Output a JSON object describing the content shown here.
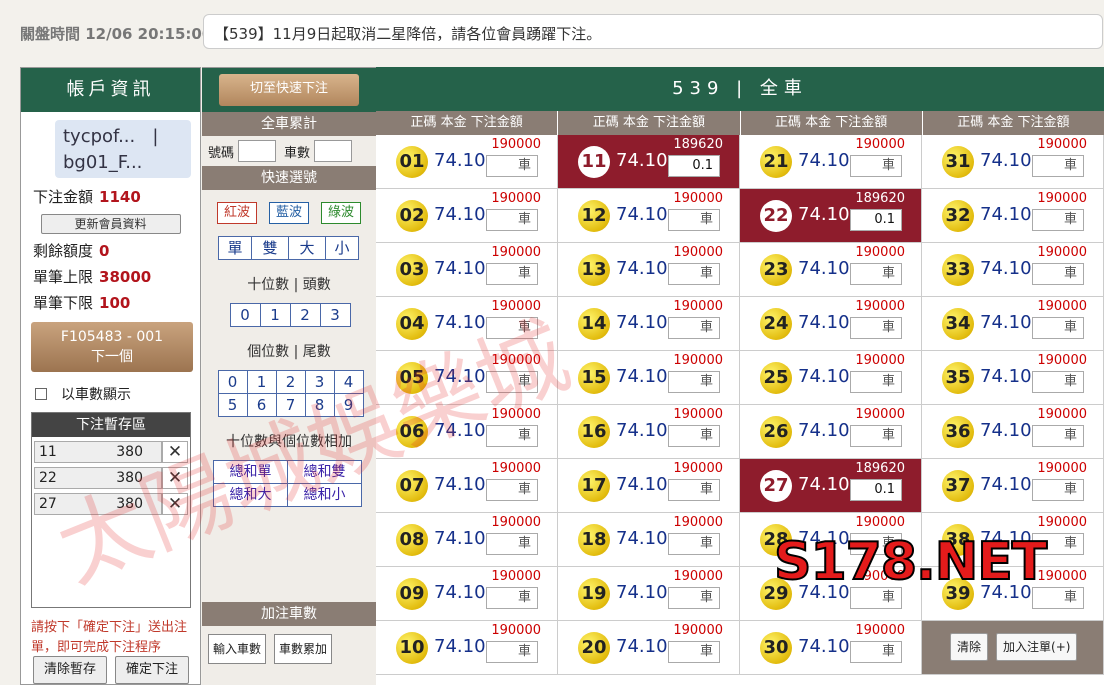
{
  "topbar": {
    "close_time": "關盤時間 12/06 20:15:00",
    "marquee": "【539】11月9日起取消二星降倍，請各位會員踴躍下注。"
  },
  "account": {
    "title": "帳戶資訊",
    "user_line1": "tycpof...",
    "user_line2": "bg01_F...",
    "user_sep": "|",
    "bet_amount_label": "下注金額",
    "bet_amount": "1140",
    "refresh_label": "更新會員資料",
    "balance_label": "剩餘額度",
    "balance": "0",
    "max_label": "單筆上限",
    "max": "38000",
    "min_label": "單筆下限",
    "min": "100",
    "next_line1": "F105483 - 001",
    "next_line2": "下一個",
    "show_by_count": "以車數顯示",
    "stash_title": "下注暫存區",
    "stash": [
      {
        "num": "11",
        "amt": "380"
      },
      {
        "num": "22",
        "amt": "380"
      },
      {
        "num": "27",
        "amt": "380"
      }
    ],
    "hint": "請按下「確定下注」送出注單，即可完成下注程序",
    "clear_label": "清除暫存",
    "confirm_label": "確定下注"
  },
  "quick": {
    "switch_label": "切至快速下注",
    "total_title": "全車累計",
    "num_label": "號碼",
    "count_label": "車數",
    "select_title": "快速選號",
    "colors": [
      "紅波",
      "藍波",
      "綠波"
    ],
    "types": [
      "單",
      "雙",
      "大",
      "小"
    ],
    "tens_caption": "十位數 | 頭數",
    "tens": [
      "0",
      "1",
      "2",
      "3"
    ],
    "units_caption": "個位數 | 尾數",
    "units": [
      "0",
      "1",
      "2",
      "3",
      "4",
      "5",
      "6",
      "7",
      "8",
      "9"
    ],
    "sum_caption": "十位數與個位數相加",
    "sums": [
      "總和單",
      "總和雙",
      "總和大",
      "總和小"
    ],
    "add_title": "加注車數",
    "input_count": "輸入車數",
    "accumulate": "車數累加"
  },
  "board": {
    "title": "539 | 全車",
    "col_header": "正碼  本金  下注金額",
    "odds": "74.10",
    "limit": "190000",
    "selected_limit": "189620",
    "placeholder": "車",
    "selected_amount": "0.1",
    "selected": [
      11,
      22,
      27
    ],
    "clear_label": "清除",
    "add_label": "加入注單(+)"
  },
  "watermark": "太陽城娛樂城",
  "logo": "S178.NET"
}
